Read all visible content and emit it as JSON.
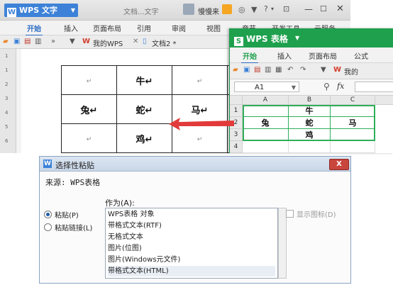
{
  "writer": {
    "app_name": "WPS 文字",
    "doc_title": "文档...文字",
    "user_name": "慢慢来",
    "menu": [
      "开始",
      "插入",
      "页面布局",
      "引用",
      "审阅",
      "视图",
      "章节",
      "开发工具",
      "云服务"
    ],
    "tabs": [
      "我的WPS",
      "文档2 *"
    ],
    "ruler_numbers": [
      "1",
      "1",
      "2",
      "3",
      "4",
      "5",
      "6"
    ],
    "table": [
      [
        "↵",
        "牛↵",
        "↵",
        "↵"
      ],
      [
        "兔↵",
        "蛇↵",
        "马↵",
        "↵"
      ],
      [
        "↵",
        "鸡↵",
        "↵",
        "↵"
      ]
    ]
  },
  "sheet": {
    "app_name": "WPS 表格",
    "menu": [
      "开始",
      "插入",
      "页面布局",
      "公式"
    ],
    "tab": "我的",
    "name_box": "A1",
    "fx": "fx",
    "columns": [
      "A",
      "B",
      "C"
    ],
    "rows": [
      "1",
      "2",
      "3",
      "4"
    ],
    "cells": [
      [
        "",
        "牛",
        ""
      ],
      [
        "兔",
        "蛇",
        "马"
      ],
      [
        "",
        "鸡",
        ""
      ],
      [
        "",
        "",
        ""
      ]
    ]
  },
  "dialog": {
    "title": "选择性粘贴",
    "source": "来源: WPS表格",
    "as_label": "作为(A):",
    "options": [
      {
        "label": "粘贴(P)",
        "selected": true
      },
      {
        "label": "粘贴链接(L)",
        "selected": false
      }
    ],
    "list": [
      "WPS表格 对象",
      "带格式文本(RTF)",
      "无格式文本",
      "图片(位图)",
      "图片(Windows元文件)",
      "带格式文本(HTML)"
    ],
    "selected_index": 5,
    "show_icon": "显示图标(D)",
    "close_label": "X"
  },
  "colors": {
    "writer_accent": "#3d82d8",
    "sheet_accent": "#1fa04d",
    "arrow": "#e23a3a",
    "dialog_close": "#c9463d"
  }
}
